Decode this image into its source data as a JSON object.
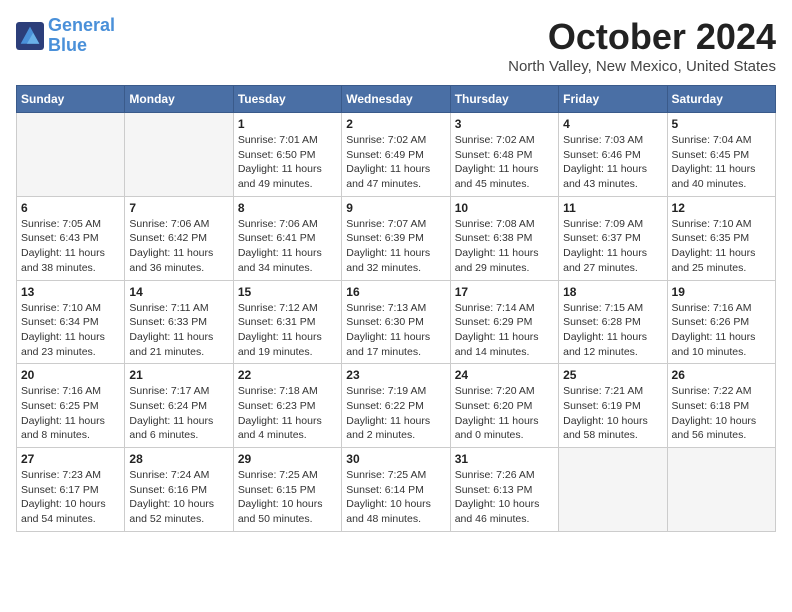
{
  "header": {
    "logo_line1": "General",
    "logo_line2": "Blue",
    "month_title": "October 2024",
    "location": "North Valley, New Mexico, United States"
  },
  "days_of_week": [
    "Sunday",
    "Monday",
    "Tuesday",
    "Wednesday",
    "Thursday",
    "Friday",
    "Saturday"
  ],
  "weeks": [
    [
      {
        "day": "",
        "sunrise": "",
        "sunset": "",
        "daylight": ""
      },
      {
        "day": "",
        "sunrise": "",
        "sunset": "",
        "daylight": ""
      },
      {
        "day": "1",
        "sunrise": "Sunrise: 7:01 AM",
        "sunset": "Sunset: 6:50 PM",
        "daylight": "Daylight: 11 hours and 49 minutes."
      },
      {
        "day": "2",
        "sunrise": "Sunrise: 7:02 AM",
        "sunset": "Sunset: 6:49 PM",
        "daylight": "Daylight: 11 hours and 47 minutes."
      },
      {
        "day": "3",
        "sunrise": "Sunrise: 7:02 AM",
        "sunset": "Sunset: 6:48 PM",
        "daylight": "Daylight: 11 hours and 45 minutes."
      },
      {
        "day": "4",
        "sunrise": "Sunrise: 7:03 AM",
        "sunset": "Sunset: 6:46 PM",
        "daylight": "Daylight: 11 hours and 43 minutes."
      },
      {
        "day": "5",
        "sunrise": "Sunrise: 7:04 AM",
        "sunset": "Sunset: 6:45 PM",
        "daylight": "Daylight: 11 hours and 40 minutes."
      }
    ],
    [
      {
        "day": "6",
        "sunrise": "Sunrise: 7:05 AM",
        "sunset": "Sunset: 6:43 PM",
        "daylight": "Daylight: 11 hours and 38 minutes."
      },
      {
        "day": "7",
        "sunrise": "Sunrise: 7:06 AM",
        "sunset": "Sunset: 6:42 PM",
        "daylight": "Daylight: 11 hours and 36 minutes."
      },
      {
        "day": "8",
        "sunrise": "Sunrise: 7:06 AM",
        "sunset": "Sunset: 6:41 PM",
        "daylight": "Daylight: 11 hours and 34 minutes."
      },
      {
        "day": "9",
        "sunrise": "Sunrise: 7:07 AM",
        "sunset": "Sunset: 6:39 PM",
        "daylight": "Daylight: 11 hours and 32 minutes."
      },
      {
        "day": "10",
        "sunrise": "Sunrise: 7:08 AM",
        "sunset": "Sunset: 6:38 PM",
        "daylight": "Daylight: 11 hours and 29 minutes."
      },
      {
        "day": "11",
        "sunrise": "Sunrise: 7:09 AM",
        "sunset": "Sunset: 6:37 PM",
        "daylight": "Daylight: 11 hours and 27 minutes."
      },
      {
        "day": "12",
        "sunrise": "Sunrise: 7:10 AM",
        "sunset": "Sunset: 6:35 PM",
        "daylight": "Daylight: 11 hours and 25 minutes."
      }
    ],
    [
      {
        "day": "13",
        "sunrise": "Sunrise: 7:10 AM",
        "sunset": "Sunset: 6:34 PM",
        "daylight": "Daylight: 11 hours and 23 minutes."
      },
      {
        "day": "14",
        "sunrise": "Sunrise: 7:11 AM",
        "sunset": "Sunset: 6:33 PM",
        "daylight": "Daylight: 11 hours and 21 minutes."
      },
      {
        "day": "15",
        "sunrise": "Sunrise: 7:12 AM",
        "sunset": "Sunset: 6:31 PM",
        "daylight": "Daylight: 11 hours and 19 minutes."
      },
      {
        "day": "16",
        "sunrise": "Sunrise: 7:13 AM",
        "sunset": "Sunset: 6:30 PM",
        "daylight": "Daylight: 11 hours and 17 minutes."
      },
      {
        "day": "17",
        "sunrise": "Sunrise: 7:14 AM",
        "sunset": "Sunset: 6:29 PM",
        "daylight": "Daylight: 11 hours and 14 minutes."
      },
      {
        "day": "18",
        "sunrise": "Sunrise: 7:15 AM",
        "sunset": "Sunset: 6:28 PM",
        "daylight": "Daylight: 11 hours and 12 minutes."
      },
      {
        "day": "19",
        "sunrise": "Sunrise: 7:16 AM",
        "sunset": "Sunset: 6:26 PM",
        "daylight": "Daylight: 11 hours and 10 minutes."
      }
    ],
    [
      {
        "day": "20",
        "sunrise": "Sunrise: 7:16 AM",
        "sunset": "Sunset: 6:25 PM",
        "daylight": "Daylight: 11 hours and 8 minutes."
      },
      {
        "day": "21",
        "sunrise": "Sunrise: 7:17 AM",
        "sunset": "Sunset: 6:24 PM",
        "daylight": "Daylight: 11 hours and 6 minutes."
      },
      {
        "day": "22",
        "sunrise": "Sunrise: 7:18 AM",
        "sunset": "Sunset: 6:23 PM",
        "daylight": "Daylight: 11 hours and 4 minutes."
      },
      {
        "day": "23",
        "sunrise": "Sunrise: 7:19 AM",
        "sunset": "Sunset: 6:22 PM",
        "daylight": "Daylight: 11 hours and 2 minutes."
      },
      {
        "day": "24",
        "sunrise": "Sunrise: 7:20 AM",
        "sunset": "Sunset: 6:20 PM",
        "daylight": "Daylight: 11 hours and 0 minutes."
      },
      {
        "day": "25",
        "sunrise": "Sunrise: 7:21 AM",
        "sunset": "Sunset: 6:19 PM",
        "daylight": "Daylight: 10 hours and 58 minutes."
      },
      {
        "day": "26",
        "sunrise": "Sunrise: 7:22 AM",
        "sunset": "Sunset: 6:18 PM",
        "daylight": "Daylight: 10 hours and 56 minutes."
      }
    ],
    [
      {
        "day": "27",
        "sunrise": "Sunrise: 7:23 AM",
        "sunset": "Sunset: 6:17 PM",
        "daylight": "Daylight: 10 hours and 54 minutes."
      },
      {
        "day": "28",
        "sunrise": "Sunrise: 7:24 AM",
        "sunset": "Sunset: 6:16 PM",
        "daylight": "Daylight: 10 hours and 52 minutes."
      },
      {
        "day": "29",
        "sunrise": "Sunrise: 7:25 AM",
        "sunset": "Sunset: 6:15 PM",
        "daylight": "Daylight: 10 hours and 50 minutes."
      },
      {
        "day": "30",
        "sunrise": "Sunrise: 7:25 AM",
        "sunset": "Sunset: 6:14 PM",
        "daylight": "Daylight: 10 hours and 48 minutes."
      },
      {
        "day": "31",
        "sunrise": "Sunrise: 7:26 AM",
        "sunset": "Sunset: 6:13 PM",
        "daylight": "Daylight: 10 hours and 46 minutes."
      },
      {
        "day": "",
        "sunrise": "",
        "sunset": "",
        "daylight": ""
      },
      {
        "day": "",
        "sunrise": "",
        "sunset": "",
        "daylight": ""
      }
    ]
  ]
}
